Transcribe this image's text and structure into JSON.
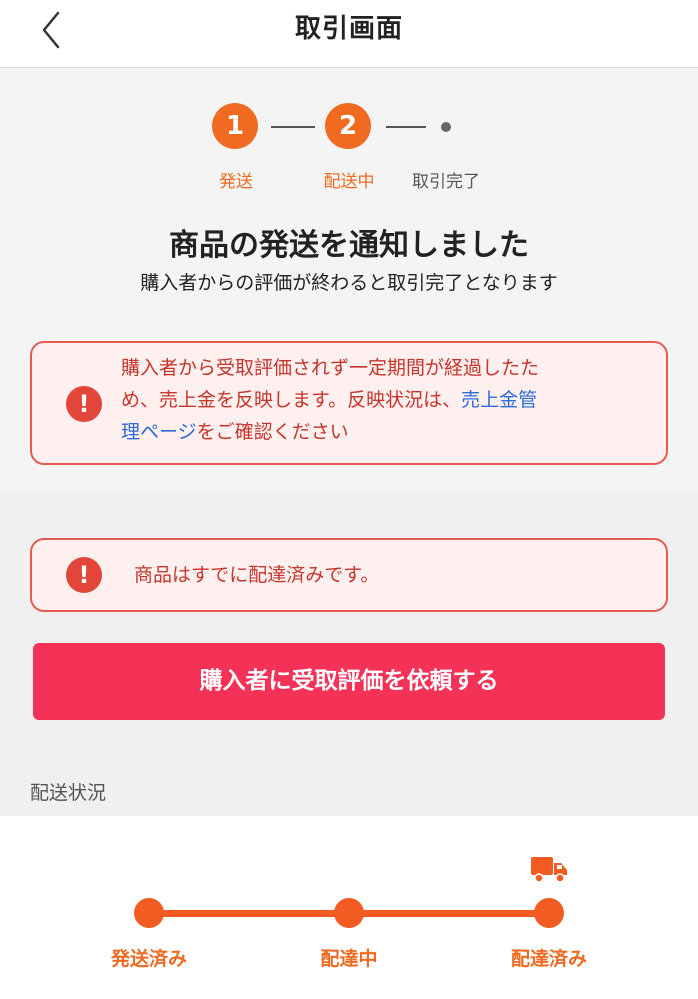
{
  "header": {
    "title": "取引画面"
  },
  "steps": [
    {
      "number": "1",
      "label": "発送"
    },
    {
      "number": "2",
      "label": "配送中"
    },
    {
      "label": "取引完了"
    }
  ],
  "status": {
    "heading": "商品の発送を通知しました",
    "subheading": "購入者からの評価が終わると取引完了となります"
  },
  "alert_reflect": {
    "icon": "!",
    "line1": "購入者から受取評価されず一定期間が経過したた",
    "line2_text": "め、売上金を反映します。反映状況は、",
    "line2_link": "売上金管",
    "line3_link": "理ページ",
    "line3_text": "をご確認ください"
  },
  "alert_delivered": {
    "icon": "!",
    "text": "商品はすでに配達済みです。"
  },
  "request_button": {
    "label": "購入者に受取評価を依頼する"
  },
  "delivery_status": {
    "section_label": "配送状況",
    "stages": [
      "発送済み",
      "配達中",
      "配達済み"
    ],
    "current_stage": "配達済み",
    "icon": "truck-icon"
  },
  "colors": {
    "accent_orange": "#f06a22",
    "alert_red": "#e2463a",
    "button_pink": "#f43258",
    "link_blue": "#2f6bd6"
  }
}
